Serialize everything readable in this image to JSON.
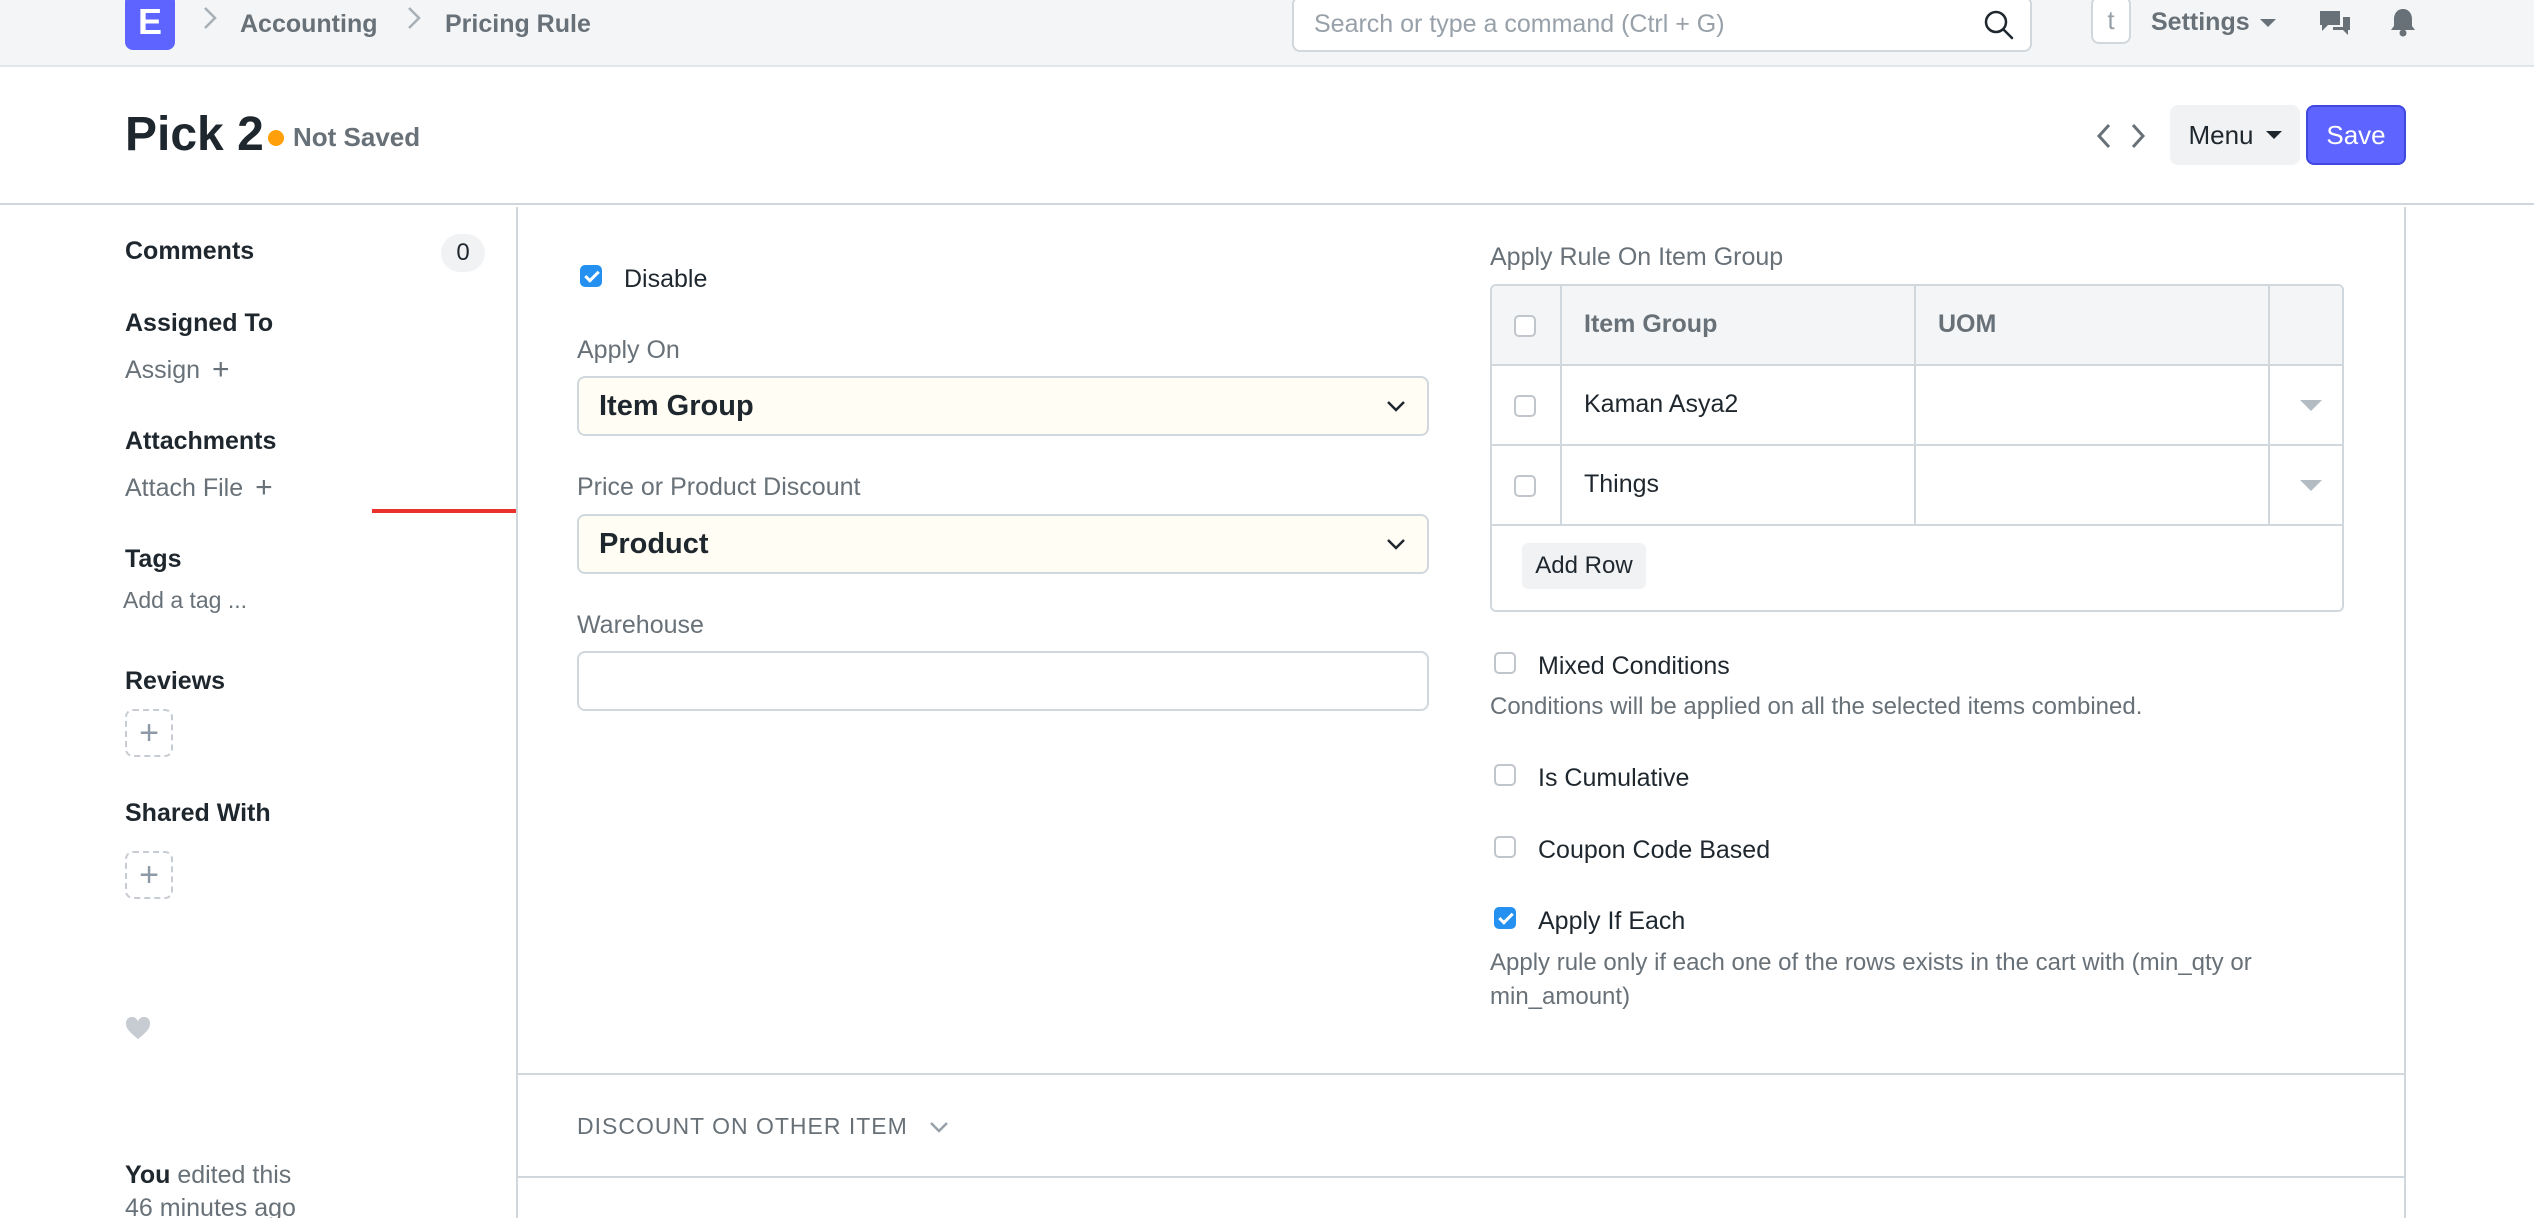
{
  "navbar": {
    "logo_letter": "E",
    "breadcrumbs": [
      "Accounting",
      "Pricing Rule"
    ],
    "search_placeholder": "Search or type a command (Ctrl + G)",
    "avatar_letter": "t",
    "settings_label": "Settings"
  },
  "page": {
    "title": "Pick 2",
    "status": "Not Saved",
    "status_color": "#ffa00a",
    "menu_label": "Menu",
    "save_label": "Save",
    "accent_color": "#5e64ff"
  },
  "sidebar": {
    "comments_label": "Comments",
    "comments_count": "0",
    "assigned_label": "Assigned To",
    "assign_link": "Assign",
    "attachments_label": "Attachments",
    "attach_link": "Attach File",
    "tags_label": "Tags",
    "tag_placeholder": "Add a tag ...",
    "reviews_label": "Reviews",
    "shared_label": "Shared With",
    "edited_user": "You",
    "edited_text": " edited this",
    "edited_time": "46 minutes ago"
  },
  "form": {
    "disable": {
      "label": "Disable",
      "checked": true
    },
    "apply_on": {
      "label": "Apply On",
      "value": "Item Group"
    },
    "price_or_product": {
      "label": "Price or Product Discount",
      "value": "Product"
    },
    "warehouse": {
      "label": "Warehouse",
      "value": ""
    },
    "apply_rule_table": {
      "label": "Apply Rule On Item Group",
      "columns": [
        "Item Group",
        "UOM"
      ],
      "rows": [
        {
          "item_group": "Kaman Asya2",
          "uom": ""
        },
        {
          "item_group": "Things",
          "uom": ""
        }
      ],
      "add_row_label": "Add Row"
    },
    "mixed_conditions": {
      "label": "Mixed Conditions",
      "checked": false,
      "help": "Conditions will be applied on all the selected items combined."
    },
    "is_cumulative": {
      "label": "Is Cumulative",
      "checked": false
    },
    "coupon_code_based": {
      "label": "Coupon Code Based",
      "checked": false
    },
    "apply_if_each": {
      "label": "Apply If Each",
      "checked": true,
      "help_line1": "Apply rule only if each one of the rows exists in the cart with (min_qty or",
      "help_line2": "min_amount)"
    },
    "discount_section_title": "DISCOUNT ON OTHER ITEM"
  },
  "icons": {
    "search": "search-icon",
    "chat": "chat-icon",
    "bell": "bell-icon",
    "heart": "heart-icon",
    "annotation_arrow_color": "#e8322b"
  }
}
